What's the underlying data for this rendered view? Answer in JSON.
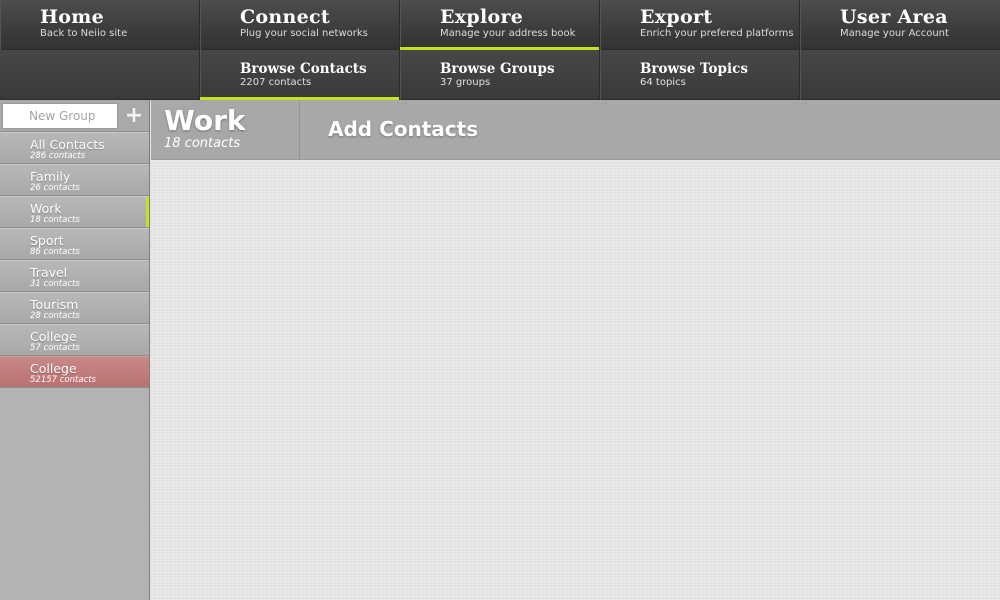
{
  "colors": {
    "accent": "#c6e21b",
    "nav_background": "#3c3c3c",
    "sidebar_background": "#b3b3b3",
    "highlight_group": "#c27e7e"
  },
  "topnav": [
    {
      "title": "Home",
      "subtitle": "Back to Neiio site"
    },
    {
      "title": "Connect",
      "subtitle": "Plug your social networks"
    },
    {
      "title": "Explore",
      "subtitle": "Manage your address book",
      "active": true
    },
    {
      "title": "Export",
      "subtitle": "Enrich your prefered platforms"
    },
    {
      "title": "User Area",
      "subtitle": "Manage your Account"
    }
  ],
  "subnav": [
    {
      "title": "Browse Contacts",
      "count": "2207 contacts",
      "active": true
    },
    {
      "title": "Browse Groups",
      "count": "37 groups"
    },
    {
      "title": "Browse Topics",
      "count": "64 topics"
    }
  ],
  "sidebar": {
    "new_group_placeholder": "New Group",
    "add_icon": "plus-icon",
    "add_symbol": "+",
    "groups": [
      {
        "name": "All Contacts",
        "count": "286 contacts"
      },
      {
        "name": "Family",
        "count": "26 contacts"
      },
      {
        "name": "Work",
        "count": "18 contacts",
        "selected": true
      },
      {
        "name": "Sport",
        "count": "86 contacts"
      },
      {
        "name": "Travel",
        "count": "31 contacts"
      },
      {
        "name": "Tourism",
        "count": "28 contacts"
      },
      {
        "name": "College",
        "count": "57 contacts"
      },
      {
        "name": "College",
        "count": "52157 contacts",
        "highlighted": true
      }
    ]
  },
  "header": {
    "group_title": "Work",
    "group_count": "18 contacts",
    "action_label": "Add Contacts"
  }
}
